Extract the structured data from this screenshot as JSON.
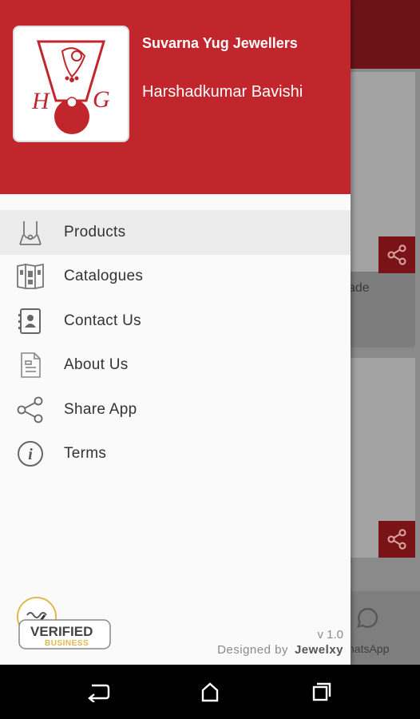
{
  "drawer": {
    "store_name": "Suvarna Yug Jewellers",
    "owner_name": "Harshadkumar Bavishi",
    "logo_letters": "H G",
    "menu": [
      {
        "label": "Products",
        "icon": "necklace-icon",
        "active": true
      },
      {
        "label": "Catalogues",
        "icon": "catalogue-icon",
        "active": false
      },
      {
        "label": "Contact Us",
        "icon": "contact-card-icon",
        "active": false
      },
      {
        "label": "About Us",
        "icon": "document-icon",
        "active": false
      },
      {
        "label": "Share App",
        "icon": "share-icon",
        "active": false
      },
      {
        "label": "Terms",
        "icon": "info-icon",
        "active": false
      }
    ],
    "badge": {
      "line1": "VERIFIED",
      "line2": "BUSINESS"
    },
    "version": "v 1.0",
    "designed_by_label": "Designed by",
    "designed_by_brand": "Jewelxy"
  },
  "background": {
    "card_text": "ade",
    "whatsapp_label": "hatsApp"
  },
  "colors": {
    "header": "#c0262c",
    "toolbar_dimmed": "#6b1317",
    "drawer_bg": "#fafafa"
  }
}
